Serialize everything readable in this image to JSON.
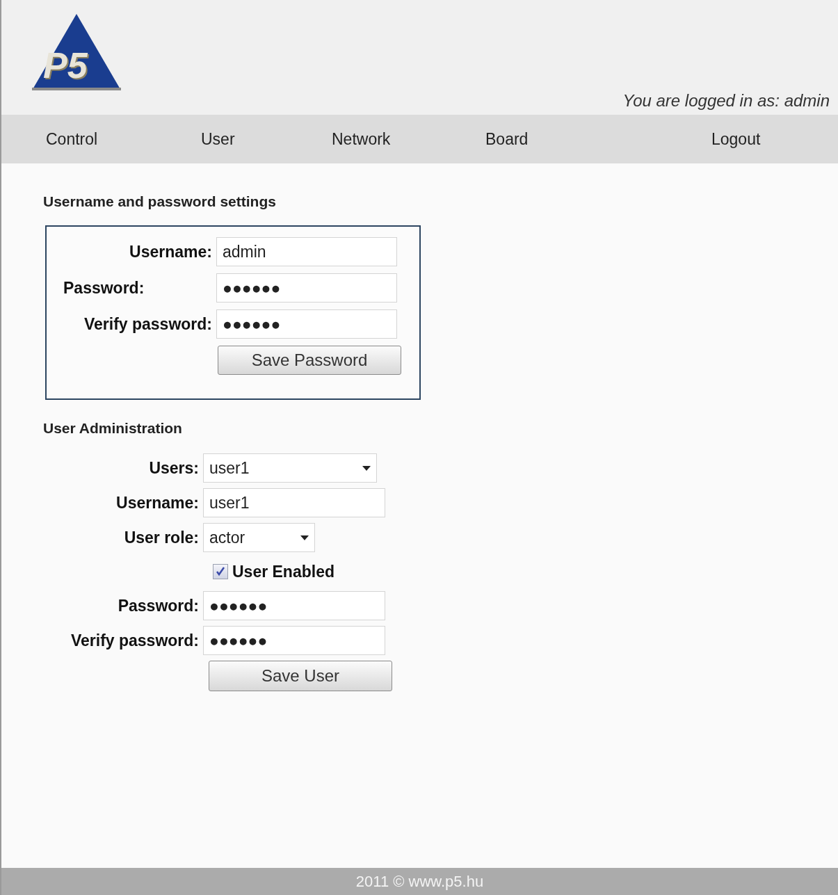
{
  "logo": {
    "text": "P5"
  },
  "login_status": "You are logged in as: admin",
  "nav": [
    {
      "label": "Control"
    },
    {
      "label": "User"
    },
    {
      "label": "Network"
    },
    {
      "label": "Board"
    },
    {
      "label": "Logout"
    }
  ],
  "password_settings": {
    "heading": "Username and password settings",
    "fields": [
      {
        "label": "Username:",
        "value": "admin"
      },
      {
        "label": "Password:",
        "value": "●●●●●●"
      },
      {
        "label": "Verify password:",
        "value": "●●●●●●"
      }
    ],
    "button": "Save Password"
  },
  "user_admin": {
    "heading": "User Administration",
    "fields": [
      {
        "kind": "select",
        "label": "Users:",
        "value": "user1"
      },
      {
        "kind": "text",
        "label": "Username:",
        "value": "user1"
      },
      {
        "kind": "select",
        "label": "User role:",
        "value": "actor"
      },
      {
        "kind": "checkbox",
        "label": "User Enabled",
        "checked": true
      },
      {
        "kind": "text",
        "label": "Password:",
        "value": "●●●●●●"
      },
      {
        "kind": "text",
        "label": "Verify password:",
        "value": "●●●●●●"
      }
    ],
    "button": "Save User"
  },
  "footer": "2011 © www.p5.hu"
}
